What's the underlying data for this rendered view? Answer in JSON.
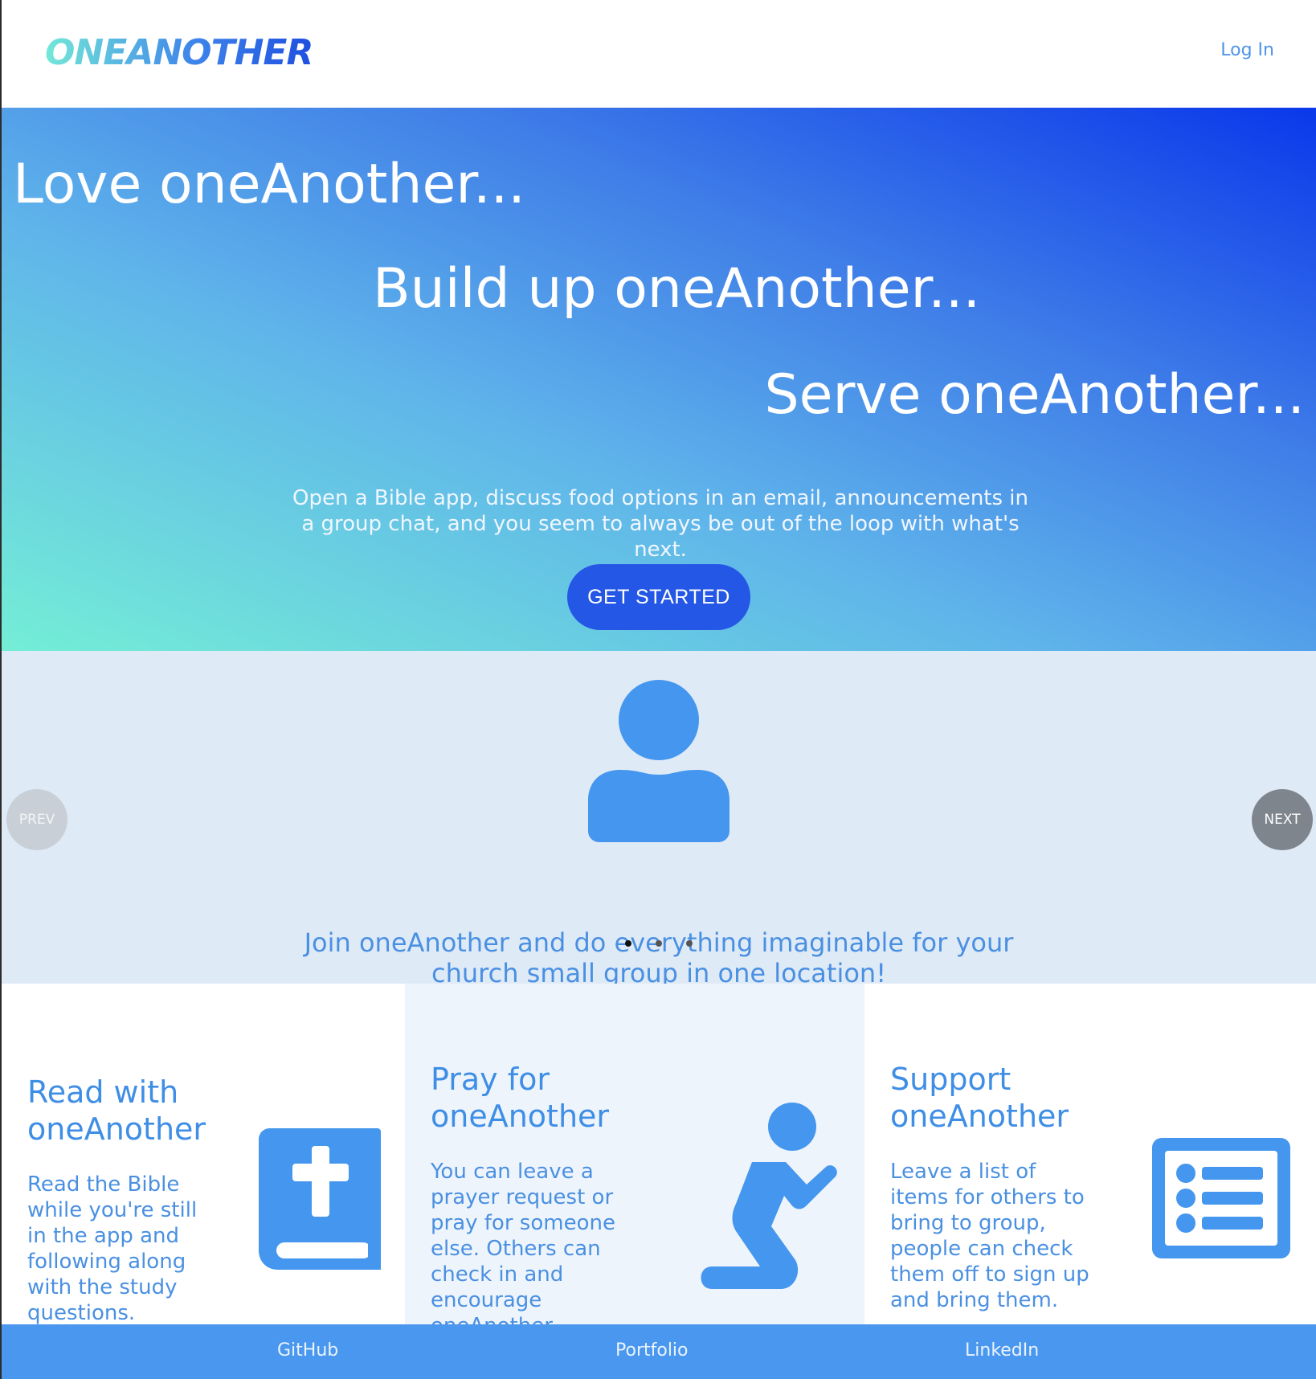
{
  "header": {
    "logo": "ONEANOTHER",
    "login_label": "Log In"
  },
  "hero": {
    "line1": "Love oneAnother...",
    "line2": "Build up oneAnother...",
    "line3": "Serve oneAnother...",
    "description": "Open a Bible app, discuss food options in an email, announcements in a group chat, and you seem to always be out of the loop with what's next.",
    "cta_label": "GET STARTED"
  },
  "carousel": {
    "icon": "person-icon",
    "prev_label": "PREV",
    "next_label": "NEXT",
    "text": "Join oneAnother and do everything imaginable for your church small group in one location!",
    "slide_count": 3,
    "active_index": 0
  },
  "features": [
    {
      "title": "Read with oneAnother",
      "description": "Read the Bible while you're still in the app and following along with the study questions.",
      "icon": "bible-icon"
    },
    {
      "title": "Pray for oneAnother",
      "description": "You can leave a prayer request or pray for someone else. Others can check in and encourage oneAnother.",
      "icon": "praying-person-icon"
    },
    {
      "title": "Support oneAnother",
      "description": "Leave a list of items for others to bring to group, people can check them off to sign up and bring them.",
      "icon": "list-icon"
    }
  ],
  "footer": {
    "links": [
      "GitHub",
      "Portfolio",
      "LinkedIn"
    ]
  },
  "colors": {
    "accent": "#4a90e2",
    "cta": "#2557e6",
    "footer": "#4997ee",
    "carousel_bg": "#dfeaf7"
  }
}
